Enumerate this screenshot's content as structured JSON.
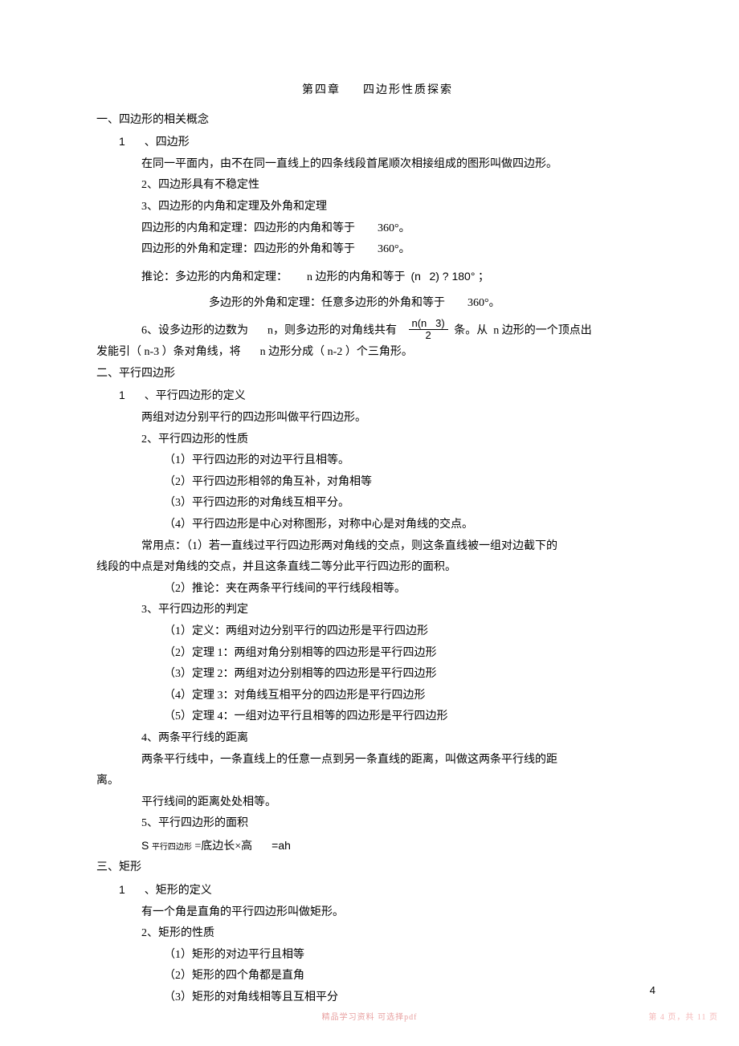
{
  "title_left": "第四章",
  "title_right": "四边形性质探索",
  "sec1": {
    "heading": "一、四边形的相关概念",
    "p1_num": "1",
    "p1_label": "、四边形",
    "p1_body": "在同一平面内，由不在同一直线上的四条线段首尾顺次相接组成的图形叫做四边形。",
    "p2": "2、四边形具有不稳定性",
    "p3": "3、四边形的内角和定理及外角和定理",
    "p3_l1a": "四边形的内角和定理：四边形的内角和等于",
    "p3_l1b": "360°。",
    "p3_l2a": "四边形的外角和定理：四边形的外角和等于",
    "p3_l2b": "360°。",
    "p3_l3a": "推论：多边形的内角和定理：",
    "p3_l3b": "n 边形的内角和等于",
    "p3_l3c": "(n",
    "p3_l3d": "2) ? 180°",
    "p3_l3e": "；",
    "p3_l4a": "多边形的外角和定理：任意多边形的外角和等于",
    "p3_l4b": "360°。",
    "p6a": "6、设多边形的边数为",
    "p6b": "n，则多边形的对角线共有",
    "p6_num": "n(n",
    "p6_num2": "3)",
    "p6_den": "2",
    "p6c": "条。从",
    "p6d": "n 边形的一个顶点出",
    "p6e": "发能引（ n-3 ）条对角线，将",
    "p6f": "n 边形分成（ n-2 ）个三角形。"
  },
  "sec2": {
    "heading": "二、平行四边形",
    "p1_num": "1",
    "p1_label": "、平行四边形的定义",
    "p1_body": "两组对边分别平行的四边形叫做平行四边形。",
    "p2": "2、平行四边形的性质",
    "p2_1": "（1）平行四边形的对边平行且相等。",
    "p2_2": "（2）平行四边形相邻的角互补，对角相等",
    "p2_3": "（3）平行四边形的对角线互相平分。",
    "p2_4": "（4）平行四边形是中心对称图形，对称中心是对角线的交点。",
    "p2_usea": "常用点：（1）若一直线过平行四边形两对角线的交点，则这条直线被一组对边截下的",
    "p2_useb": "线段的中点是对角线的交点，并且这条直线二等分此平行四边形的面积。",
    "p2_use2": "（2）推论：夹在两条平行线间的平行线段相等。",
    "p3": "3、平行四边形的判定",
    "p3_1": "（1）定义：两组对边分别平行的四边形是平行四边形",
    "p3_2": "（2）定理  1：两组对角分别相等的四边形是平行四边形",
    "p3_3": "（3）定理  2：两组对边分别相等的四边形是平行四边形",
    "p3_4": "（4）定理  3：对角线互相平分的四边形是平行四边形",
    "p3_5": "（5）定理  4：一组对边平行且相等的四边形是平行四边形",
    "p4": "4、两条平行线的距离",
    "p4_a": "两条平行线中，一条直线上的任意一点到另一条直线的距离，叫做这两条平行线的距",
    "p4_b": "离。",
    "p4_c": "平行线间的距离处处相等。",
    "p5": "5、平行四边形的面积",
    "p5_a1": "S",
    "p5_a2": "平行四边形",
    "p5_a3": "=底边长×高",
    "p5_a4": "=ah"
  },
  "sec3": {
    "heading": "三、矩形",
    "p1_num": "1",
    "p1_label": "、矩形的定义",
    "p1_body": "有一个角是直角的平行四边形叫做矩形。",
    "p2": "2、矩形的性质",
    "p2_1": "（1）矩形的对边平行且相等",
    "p2_2": "（2）矩形的四个角都是直角",
    "p2_3": "（3）矩形的对角线相等且互相平分"
  },
  "page_number": "4",
  "footer_center": "精品学习资料   可选择pdf",
  "footer_right": "第 4 页，共 11 页"
}
